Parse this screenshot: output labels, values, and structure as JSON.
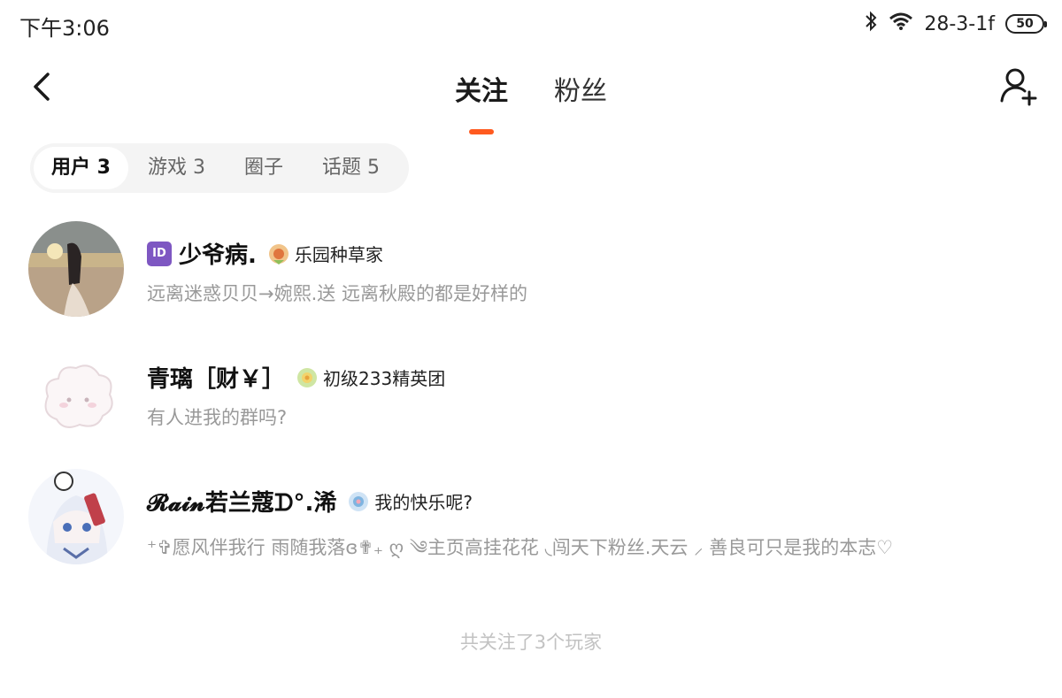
{
  "status_bar": {
    "time": "下午3:06",
    "network_text": "28-3-1f",
    "battery": "50",
    "icons": [
      "bluetooth-icon",
      "wifi-icon",
      "battery-icon"
    ]
  },
  "header": {
    "back_icon": "chevron-left-icon",
    "tabs": [
      {
        "label": "关注",
        "active": true
      },
      {
        "label": "粉丝",
        "active": false
      }
    ],
    "add_user_icon": "add-user-icon",
    "accent_color": "#ff5a1f"
  },
  "segment": {
    "items": [
      {
        "label": "用户 3",
        "active": true
      },
      {
        "label": "游戏 3",
        "active": false
      },
      {
        "label": "圈子",
        "active": false
      },
      {
        "label": "话题 5",
        "active": false
      }
    ]
  },
  "users": [
    {
      "id_badge": "ID",
      "name": "少爷病.",
      "title_badge": "乐园种草家",
      "signature": "远离迷惑贝贝→婉熙.送 远离秋殿的都是好样的"
    },
    {
      "name": "青璃［财￥］",
      "title_badge": "初级233精英团",
      "signature": "有人进我的群吗?"
    },
    {
      "name": "𝓡𝓪𝓲𝓷若兰蔻ᗪ°.浠",
      "title_badge": "我的快乐呢?",
      "signature": "⁺✞愿风伴我行 雨随我落ɞ✟₊ ღ ༄主页高挂花花 ◟闯天下粉丝.天云 ⸝ 善良可只是我的本志♡"
    }
  ],
  "footer": {
    "note": "共关注了3个玩家"
  }
}
